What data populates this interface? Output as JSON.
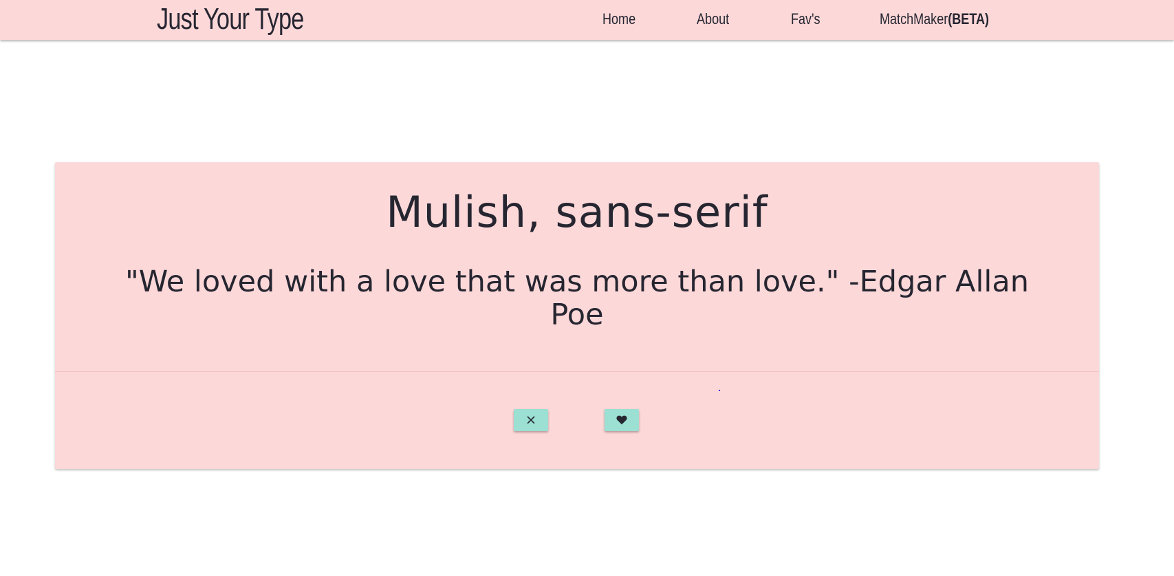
{
  "navbar": {
    "brand": "Just Your Type",
    "links": {
      "home": "Home",
      "about": "About",
      "favs": "Fav's",
      "matchmaker": "MatchMaker",
      "matchmaker_tag": "(BETA)"
    }
  },
  "card": {
    "title": "Mulish, sans-serif",
    "quote": "\"We loved with a love that was more than love.\" -Edgar Allan Poe",
    "actions": {
      "reject_icon": "close-icon",
      "like_icon": "heart-icon"
    }
  },
  "colors": {
    "navbar_bg": "#fdd8d9",
    "card_bg": "#fdd8d9",
    "button_bg": "#9be0d3",
    "text": "#262631"
  }
}
